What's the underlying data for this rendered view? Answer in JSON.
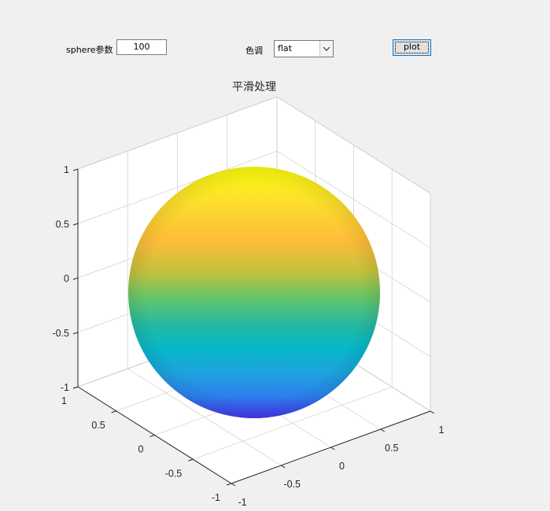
{
  "controls": {
    "sphere_label": "sphere参数",
    "sphere_value": "100",
    "tone_label": "色调",
    "tone_selected": "flat",
    "plot_button": "plot"
  },
  "axes": {
    "title": "平滑处理",
    "z_ticks": [
      "1",
      "0.5",
      "0",
      "-0.5",
      "-1"
    ],
    "y_ticks": [
      "1",
      "0.5",
      "0",
      "-0.5",
      "-1"
    ],
    "x_ticks": [
      "-1",
      "-0.5",
      "0",
      "0.5",
      "1"
    ]
  },
  "colors": {
    "background": "#f0f0f0",
    "axes_background": "#ffffff",
    "grid": "#dcdcdc",
    "sphere_top": "#f9fb0e",
    "sphere_upper": "#fdbb3a",
    "sphere_mid": "#3fbc73",
    "sphere_lower": "#06b8c8",
    "sphere_bottom": "#4535e8"
  }
}
